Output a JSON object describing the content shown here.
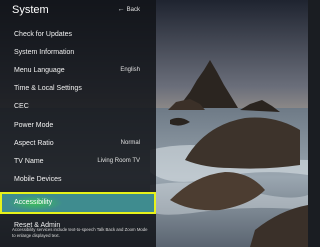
{
  "header": {
    "title": "System",
    "back_label": "Back",
    "back_icon": "back-arrow-icon"
  },
  "menu": {
    "items": [
      {
        "label": "Check for Updates",
        "value": ""
      },
      {
        "label": "System Information",
        "value": ""
      },
      {
        "label": "Menu Language",
        "value": "English"
      },
      {
        "label": "Time & Local Settings",
        "value": ""
      },
      {
        "label": "CEC",
        "value": ""
      },
      {
        "label": "Power Mode",
        "value": ""
      },
      {
        "label": "Aspect Ratio",
        "value": "Normal"
      },
      {
        "label": "TV Name",
        "value": "Living Room TV"
      },
      {
        "label": "Mobile Devices",
        "value": ""
      },
      {
        "label": "Accessibility",
        "value": ""
      },
      {
        "label": "Reset & Admin",
        "value": ""
      }
    ],
    "selected_index": 9
  },
  "hint_text": "Accessibility services include text-to-speech Talk Back and Zoom Mode to enlarge displayed text.",
  "colors": {
    "panel_bg": "#121418",
    "selected_bg": "#3f8c8f",
    "selected_outline": "#e7f21b"
  }
}
